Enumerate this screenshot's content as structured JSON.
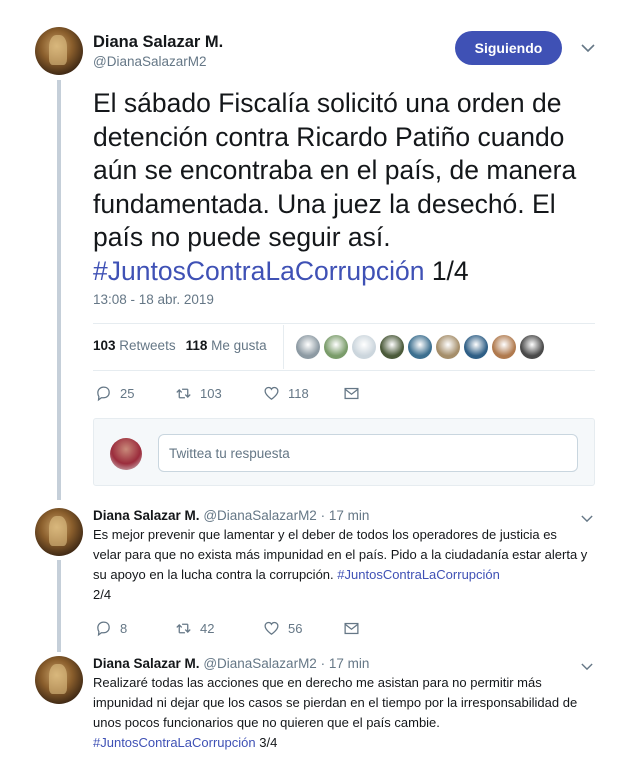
{
  "main_tweet": {
    "display_name": "Diana Salazar M.",
    "handle": "@DianaSalazarM2",
    "follow_label": "Siguiendo",
    "text": "El sábado Fiscalía solicitó una orden de detención contra Ricardo Patiño cuando aún se encontraba en el país, de manera fundamentada. Una juez la desechó. El país no puede seguir así.",
    "hashtag": "#JuntosContraLaCorrupción",
    "suffix": " 1/4",
    "timestamp": "13:08 - 18 abr. 2019",
    "retweets_count": "103",
    "retweets_label": "Retweets",
    "likes_count": "118",
    "likes_label": "Me gusta",
    "reply_count": "25",
    "retweet_action_count": "103",
    "like_action_count": "118"
  },
  "liker_colors": [
    "#8d9aa3",
    "#7a9c6a",
    "#ccd6dd",
    "#4b5a3a",
    "#3c6f8f",
    "#a58e6a",
    "#2f5f86",
    "#b07a4e",
    "#4a4a4a"
  ],
  "reply_box": {
    "placeholder": "Twittea tu respuesta"
  },
  "thread": [
    {
      "display_name": "Diana Salazar M.",
      "handle": "@DianaSalazarM2",
      "time": "· 17 min",
      "text": "Es mejor prevenir que lamentar y el deber de todos los operadores de justicia es velar para que no exista más impunidad en el país. Pido a la ciudadanía estar alerta y su apoyo en la lucha contra la corrupción.",
      "hashtag": "#JuntosContraLaCorrupción",
      "suffix": "2/4",
      "reply_count": "8",
      "retweet_count": "42",
      "like_count": "56"
    },
    {
      "display_name": "Diana Salazar M.",
      "handle": "@DianaSalazarM2",
      "time": "· 17 min",
      "text": "Realizaré todas las acciones que en derecho me asistan para no permitir más impunidad ni dejar que los casos se pierdan en el tiempo por la irresponsabilidad de unos pocos funcionarios que no quieren que el país cambie.",
      "hashtag": "#JuntosContraLaCorrupción",
      "suffix": " 3/4"
    }
  ]
}
